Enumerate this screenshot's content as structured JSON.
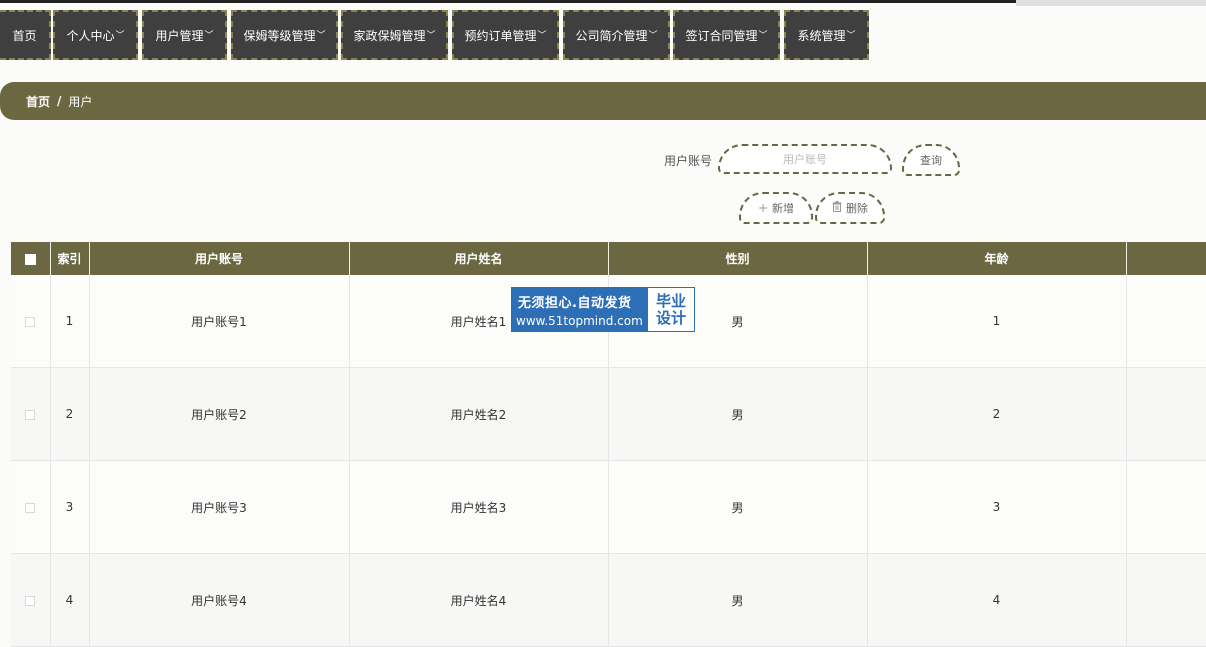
{
  "nav": {
    "items": [
      {
        "label": "首页",
        "has_dropdown": false
      },
      {
        "label": "个人中心",
        "has_dropdown": true
      },
      {
        "label": "用户管理",
        "has_dropdown": true
      },
      {
        "label": "保姆等级管理",
        "has_dropdown": true
      },
      {
        "label": "家政保姆管理",
        "has_dropdown": true
      },
      {
        "label": "预约订单管理",
        "has_dropdown": true
      },
      {
        "label": "公司简介管理",
        "has_dropdown": true
      },
      {
        "label": "签订合同管理",
        "has_dropdown": true
      },
      {
        "label": "系统管理",
        "has_dropdown": true
      }
    ],
    "chevron": "﹀"
  },
  "breadcrumb": {
    "home": "首页",
    "separator": "/",
    "current": "用户"
  },
  "search": {
    "label": "用户账号",
    "value": "",
    "placeholder": "用户账号",
    "query_button": "查询"
  },
  "actions": {
    "add": {
      "icon": "plus-icon",
      "glyph": "+",
      "label": "新增"
    },
    "delete": {
      "icon": "trash-icon",
      "glyph": "🗑",
      "label": "删除"
    }
  },
  "table": {
    "headers": [
      "索引",
      "用户账号",
      "用户姓名",
      "性别",
      "年龄"
    ],
    "rows": [
      {
        "index": "1",
        "account": "用户账号1",
        "name": "用户姓名1",
        "gender": "男",
        "age": "1"
      },
      {
        "index": "2",
        "account": "用户账号2",
        "name": "用户姓名2",
        "gender": "男",
        "age": "2"
      },
      {
        "index": "3",
        "account": "用户账号3",
        "name": "用户姓名3",
        "gender": "男",
        "age": "3"
      },
      {
        "index": "4",
        "account": "用户账号4",
        "name": "用户姓名4",
        "gender": "男",
        "age": "4"
      }
    ]
  },
  "watermark": {
    "line1": "无须担心.自动发货",
    "line2": "www.51topmind.com",
    "right1": "毕业",
    "right2": "设计"
  },
  "colors": {
    "accent": "#6b6741",
    "nav_bg": "#3f3f3f",
    "nav_border": "#8a8352",
    "watermark_blue": "#2d6fb7"
  }
}
